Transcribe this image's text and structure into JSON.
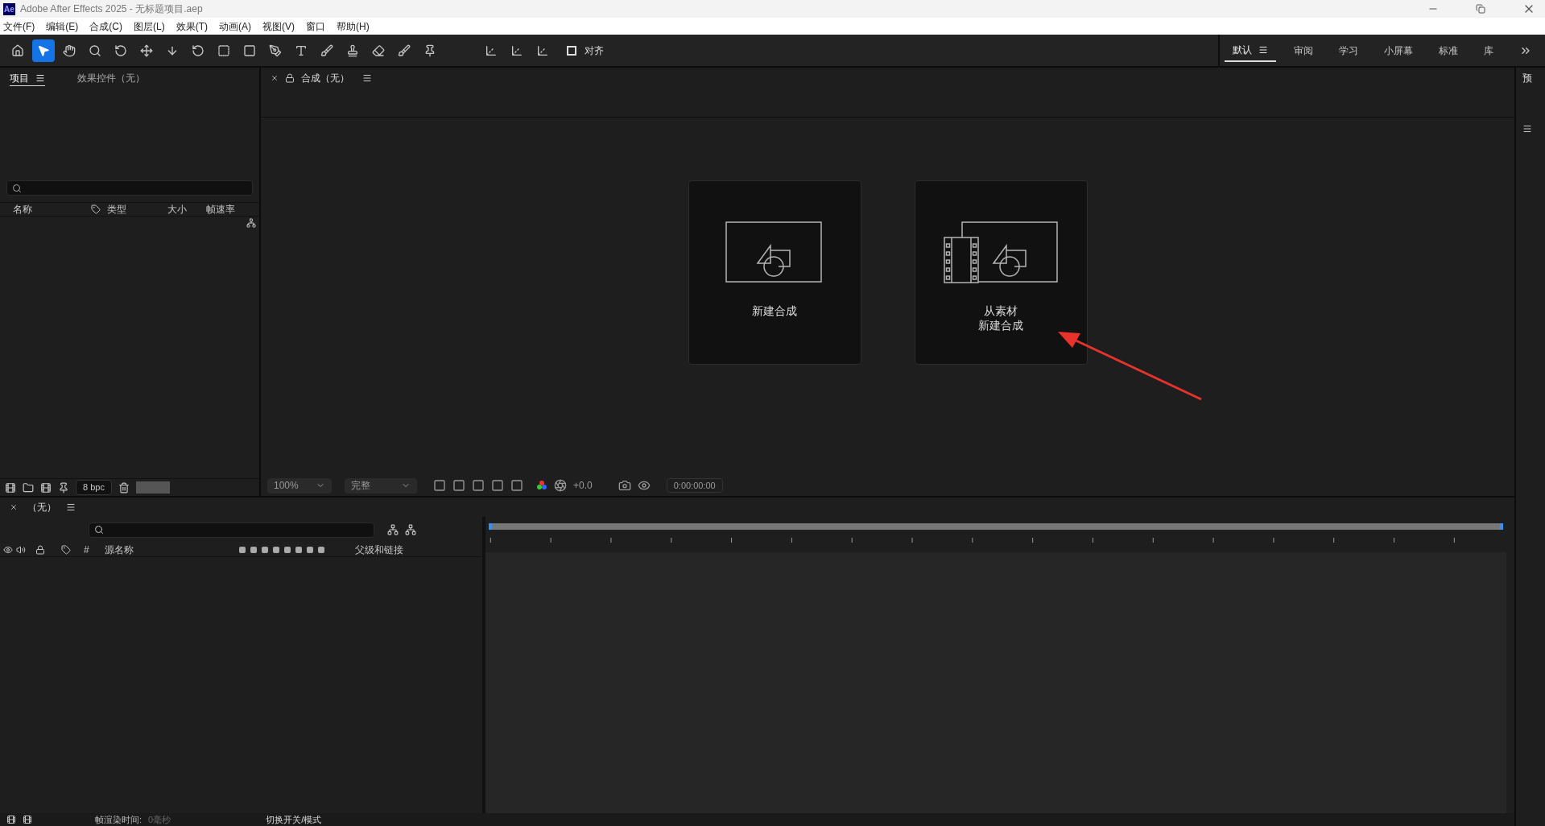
{
  "window": {
    "title": "Adobe After Effects 2025 - 无标题项目.aep",
    "app_badge": "Ae"
  },
  "menu": [
    "文件(F)",
    "编辑(E)",
    "合成(C)",
    "图层(L)",
    "效果(T)",
    "动画(A)",
    "视图(V)",
    "窗口",
    "帮助(H)"
  ],
  "snap": {
    "label": "对齐",
    "checked": false
  },
  "workspaces": [
    {
      "label": "默认",
      "selected": true
    },
    {
      "label": "审阅",
      "selected": false
    },
    {
      "label": "学习",
      "selected": false
    },
    {
      "label": "小屏幕",
      "selected": false
    },
    {
      "label": "标准",
      "selected": false
    },
    {
      "label": "库",
      "selected": false
    }
  ],
  "project_panel": {
    "tabs": [
      {
        "label": "项目",
        "selected": true
      },
      {
        "label": "效果控件（无）",
        "selected": false
      }
    ],
    "columns": [
      "名称",
      "类型",
      "大小",
      "帧速率"
    ],
    "bpc": "8 bpc"
  },
  "composition_panel": {
    "tab": "合成（无）",
    "cards": [
      {
        "kind": "new",
        "lines": [
          "新建合成"
        ]
      },
      {
        "kind": "footage",
        "lines": [
          "从素材",
          "新建合成"
        ]
      }
    ],
    "zoom": "100%",
    "resolution": "完整",
    "exposure": "+0.0",
    "timecode": "0:00:00:00"
  },
  "timeline": {
    "tab": "（无）",
    "columns": [
      "#",
      "源名称",
      "父级和链接"
    ]
  },
  "status": {
    "label": "帧渲染时间:",
    "value": "0毫秒",
    "toggle": "切换开关/模式"
  },
  "right_panel": {
    "tab": "预"
  }
}
